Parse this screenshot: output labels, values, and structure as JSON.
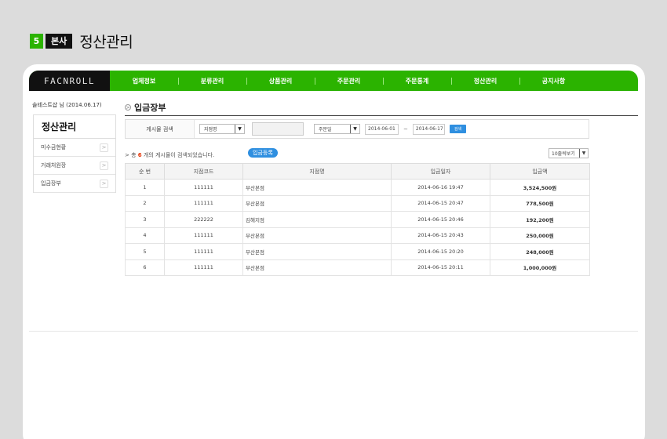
{
  "heading": {
    "step": "5",
    "section": "본사",
    "title": "정산관리"
  },
  "logo": "FACNROLL",
  "nav": [
    "업체정보",
    "분류관리",
    "상품관리",
    "주문관리",
    "주문통계",
    "정산관리",
    "공지사항"
  ],
  "user_line": "솔테스트샵 님 (2014.06.17)",
  "sidebar": {
    "title": "정산관리",
    "items": [
      {
        "label": "미수금현황",
        "arrow": ">"
      },
      {
        "label": "거래처원장",
        "arrow": ">"
      },
      {
        "label": "입금장부",
        "arrow": ">"
      }
    ]
  },
  "main": {
    "title_icon": ">",
    "title": "입금장부",
    "search": {
      "label": "게시물 검색",
      "field_select": "지점명",
      "keyword": "",
      "date_select": "주문일",
      "date_from": "2014-06-01",
      "tilde": "~",
      "date_to": "2014-06-17",
      "button": "검색"
    },
    "result": {
      "prefix": "> 총 ",
      "count": "6",
      "suffix": " 개의 게시물이 검색되었습니다."
    },
    "register_button": "입금등록",
    "per_page": "10줄씩보기",
    "caret": "▼",
    "table": {
      "headers": [
        "순 번",
        "지점코드",
        "지점명",
        "입금일자",
        "입금액"
      ],
      "rows": [
        [
          "1",
          "111111",
          "부산본점",
          "2014-06-16 19:47",
          "3,524,500원"
        ],
        [
          "2",
          "111111",
          "부산본점",
          "2014-06-15 20:47",
          "778,500원"
        ],
        [
          "3",
          "222222",
          "김해지점",
          "2014-06-15 20:46",
          "192,200원"
        ],
        [
          "4",
          "111111",
          "부산본점",
          "2014-06-15 20:43",
          "250,000원"
        ],
        [
          "5",
          "111111",
          "부산본점",
          "2014-06-15 20:20",
          "248,000원"
        ],
        [
          "6",
          "111111",
          "부산본점",
          "2014-06-15 20:11",
          "1,000,000원"
        ]
      ]
    }
  },
  "colors": {
    "accent_green": "#2bb300",
    "button_blue": "#2f8fe0",
    "count_red": "#e53100"
  }
}
